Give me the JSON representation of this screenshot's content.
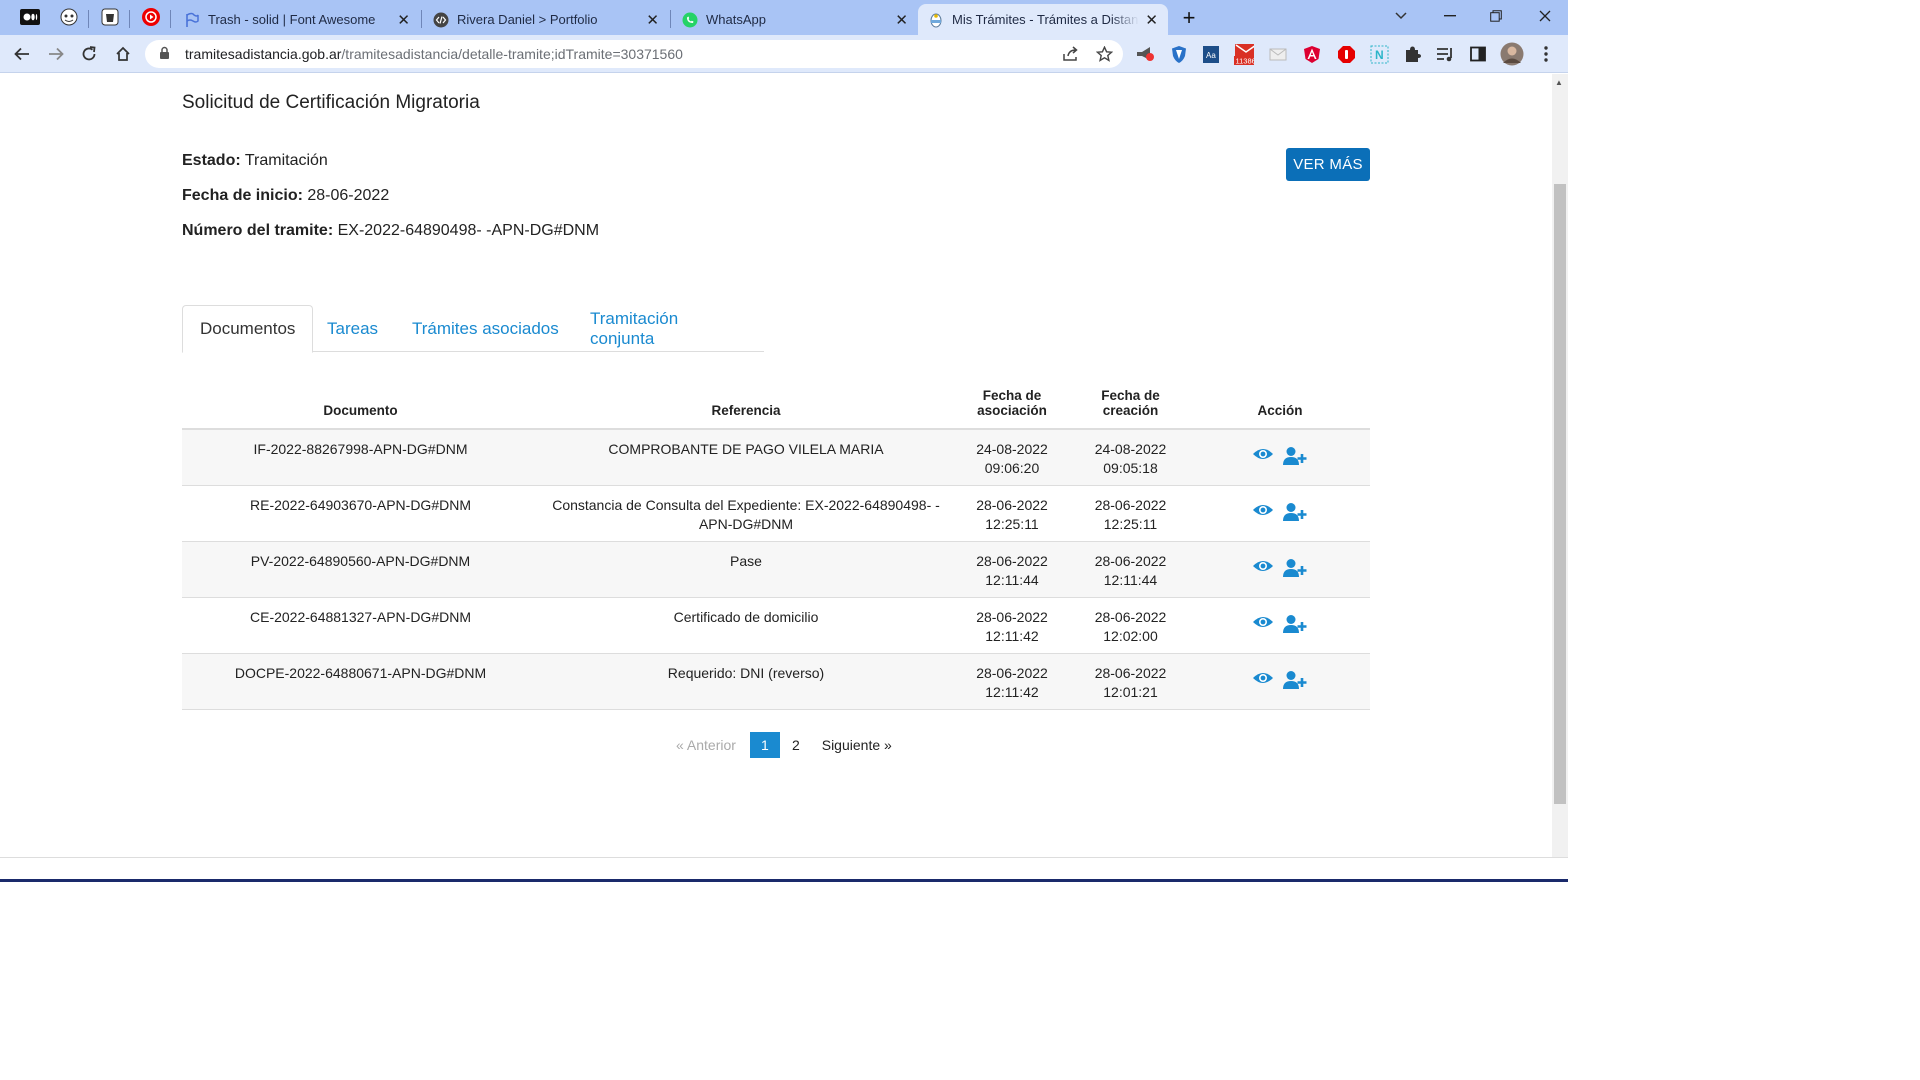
{
  "browser": {
    "tabs": [
      {
        "title": "Trash - solid | Font Awesome",
        "icon": "flag-icon"
      },
      {
        "title": "Rivera Daniel > Portfolio",
        "icon": "code-icon"
      },
      {
        "title": "WhatsApp",
        "icon": "whatsapp-icon"
      },
      {
        "title": "Mis Trámites - Trámites a Distancia",
        "icon": "argentina-emblem-icon",
        "active": true
      }
    ],
    "url_host": "tramitesadistancia.gob.ar",
    "url_path": "/tramitesadistancia/detalle-tramite;idTramite=30371560",
    "mail_badge": "11386"
  },
  "page": {
    "title": "Solicitud de Certificación Migratoria",
    "estado_label": "Estado:",
    "estado_value": "Tramitación",
    "fecha_label": "Fecha de inicio:",
    "fecha_value": "28-06-2022",
    "numero_label": "Número del tramite:",
    "numero_value": "EX-2022-64890498- -APN-DG#DNM",
    "ver_mas": "VER MÁS",
    "tabs": [
      "Documentos",
      "Tareas",
      "Trámites asociados",
      "Tramitación conjunta"
    ],
    "table": {
      "headers": {
        "documento": "Documento",
        "referencia": "Referencia",
        "fecha_asoc_1": "Fecha de",
        "fecha_asoc_2": "asociación",
        "fecha_crea_1": "Fecha de",
        "fecha_crea_2": "creación",
        "accion": "Acción"
      },
      "rows": [
        {
          "documento": "IF-2022-88267998-APN-DG#DNM",
          "referencia": "COMPROBANTE DE PAGO VILELA MARIA",
          "asoc_fecha": "24-08-2022",
          "asoc_hora": "09:06:20",
          "crea_fecha": "24-08-2022",
          "crea_hora": "09:05:18"
        },
        {
          "documento": "RE-2022-64903670-APN-DG#DNM",
          "referencia": "Constancia de Consulta del Expediente: EX-2022-64890498- -APN-DG#DNM",
          "asoc_fecha": "28-06-2022",
          "asoc_hora": "12:25:11",
          "crea_fecha": "28-06-2022",
          "crea_hora": "12:25:11"
        },
        {
          "documento": "PV-2022-64890560-APN-DG#DNM",
          "referencia": "Pase",
          "asoc_fecha": "28-06-2022",
          "asoc_hora": "12:11:44",
          "crea_fecha": "28-06-2022",
          "crea_hora": "12:11:44"
        },
        {
          "documento": "CE-2022-64881327-APN-DG#DNM",
          "referencia": "Certificado de domicilio",
          "asoc_fecha": "28-06-2022",
          "asoc_hora": "12:11:42",
          "crea_fecha": "28-06-2022",
          "crea_hora": "12:02:00"
        },
        {
          "documento": "DOCPE-2022-64880671-APN-DG#DNM",
          "referencia": "Requerido: DNI (reverso)",
          "asoc_fecha": "28-06-2022",
          "asoc_hora": "12:11:42",
          "crea_fecha": "28-06-2022",
          "crea_hora": "12:01:21"
        }
      ]
    },
    "pagination": {
      "prev": "« Anterior",
      "pages": [
        "1",
        "2"
      ],
      "current": "1",
      "next": "Siguiente »"
    }
  },
  "colors": {
    "primary": "#0b6fb8",
    "link": "#1a8ad0",
    "tabstrip": "#a9c4f5",
    "toolbar": "#dfe9fb"
  }
}
